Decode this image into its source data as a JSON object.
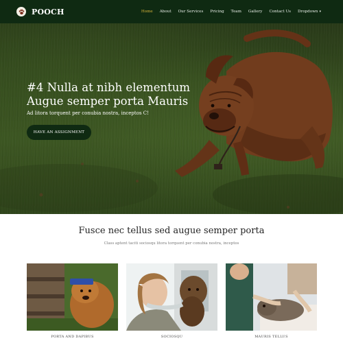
{
  "brand": {
    "name": "POOCH",
    "logo_icon": "paw-icon"
  },
  "nav": {
    "items": [
      {
        "label": "Home",
        "active": true
      },
      {
        "label": "About"
      },
      {
        "label": "Our Services"
      },
      {
        "label": "Pricing"
      },
      {
        "label": "Team"
      },
      {
        "label": "Gallery"
      },
      {
        "label": "Contact Us"
      },
      {
        "label": "Dropdown"
      }
    ]
  },
  "hero": {
    "title": "#4 Nulla at nibh elementum Augue semper porta Mauris",
    "subtitle": "Ad litora torquent per conubia nostra, inceptos C!",
    "button_label": "HAVE AN ASSIGNMENT"
  },
  "section": {
    "title": "Fusce nec tellus sed augue semper porta",
    "subtitle": "Class aptent taciti sociosqu litora torquent per conubia nostra, inceptos"
  },
  "cards": [
    {
      "label": "PORTA AND DAPIBUS"
    },
    {
      "label": "SOCIOSQU"
    },
    {
      "label": "MAURIS TELLUS"
    }
  ],
  "colors": {
    "nav_bg": "#0f2a12",
    "accent": "#d8b43a",
    "button_bg": "#0f2a12"
  }
}
